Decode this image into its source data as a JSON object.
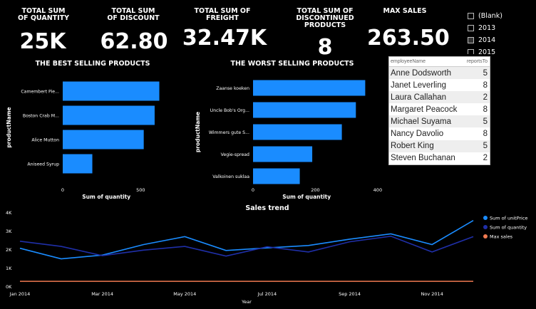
{
  "kpis": [
    {
      "title": "TOTAL SUM OF QUANTITY",
      "value": "25K"
    },
    {
      "title": "TOTAL SUM OF DISCOUNT",
      "value": "62.80"
    },
    {
      "title": "TOTAL SUM OF FREIGHT",
      "value": "32.47K"
    },
    {
      "title": "TOTAL SUM OF DISCONTINUED PRODUCTS",
      "value": "8"
    },
    {
      "title": "MAX SALES",
      "value": "263.50"
    }
  ],
  "slicer": {
    "items": [
      {
        "label": "(Blank)",
        "checked": false
      },
      {
        "label": "2013",
        "checked": false
      },
      {
        "label": "2014",
        "checked": true
      },
      {
        "label": "2015",
        "checked": false
      }
    ]
  },
  "employee_table": {
    "headers": [
      "employeeName",
      "reportsTo"
    ],
    "rows": [
      [
        "Anne Dodsworth",
        "5"
      ],
      [
        "Janet Leverling",
        "8"
      ],
      [
        "Laura Callahan",
        "2"
      ],
      [
        "Margaret Peacock",
        "8"
      ],
      [
        "Michael Suyama",
        "5"
      ],
      [
        "Nancy Davolio",
        "8"
      ],
      [
        "Robert King",
        "5"
      ],
      [
        "Steven Buchanan",
        "2"
      ]
    ]
  },
  "chart_data": [
    {
      "type": "bar",
      "orientation": "horizontal",
      "title": "THE BEST SELLING PRODUCTS",
      "categories": [
        "Camembert Pie...",
        "Boston Crab M...",
        "Alice Mutton",
        "Aniseed Syrup"
      ],
      "values": [
        620,
        590,
        520,
        190
      ],
      "xlabel": "Sum of quantity",
      "ylabel": "productName",
      "xticks": [
        "0",
        "500"
      ],
      "xlim": [
        0,
        700
      ],
      "color": "#1a8cff"
    },
    {
      "type": "bar",
      "orientation": "horizontal",
      "title": "THE WORST SELLING PRODUCTS",
      "categories": [
        "Zaanse koeken",
        "Uncle Bob's Org...",
        "Wimmers gute S...",
        "Vegie-spread",
        "Valkoinen suklaa"
      ],
      "values": [
        360,
        330,
        285,
        190,
        150
      ],
      "xlabel": "Sum of quantity",
      "ylabel": "productName",
      "xticks": [
        "0",
        "200",
        "400"
      ],
      "xlim": [
        0,
        430
      ],
      "color": "#1a8cff"
    },
    {
      "type": "line",
      "title": "Sales trend",
      "xlabel": "Year",
      "x": [
        "Jan 2014",
        "Feb 2014",
        "Mar 2014",
        "Apr 2014",
        "May 2014",
        "Jun 2014",
        "Jul 2014",
        "Aug 2014",
        "Sep 2014",
        "Oct 2014",
        "Nov 2014",
        "Dec 2014"
      ],
      "xticks": [
        "Jan 2014",
        "Mar 2014",
        "May 2014",
        "Jul 2014",
        "Sep 2014",
        "Nov 2014"
      ],
      "yticks": [
        "0K",
        "1K",
        "2K",
        "3K",
        "4K"
      ],
      "ylim": [
        0,
        4000
      ],
      "series": [
        {
          "name": "Sum of unitPrice",
          "color": "#1a8cff",
          "values": [
            2050,
            1480,
            1680,
            2250,
            2680,
            1930,
            2070,
            2200,
            2540,
            2830,
            2250,
            3550
          ]
        },
        {
          "name": "Sum of quantity",
          "color": "#1f2fa8",
          "values": [
            2430,
            2150,
            1650,
            1950,
            2150,
            1630,
            2130,
            1850,
            2400,
            2700,
            1850,
            2680
          ]
        },
        {
          "name": "Max sales",
          "color": "#f07a50",
          "values": [
            263.5,
            263.5,
            263.5,
            263.5,
            263.5,
            263.5,
            263.5,
            263.5,
            263.5,
            263.5,
            263.5,
            263.5
          ]
        }
      ],
      "legend": "right"
    }
  ]
}
